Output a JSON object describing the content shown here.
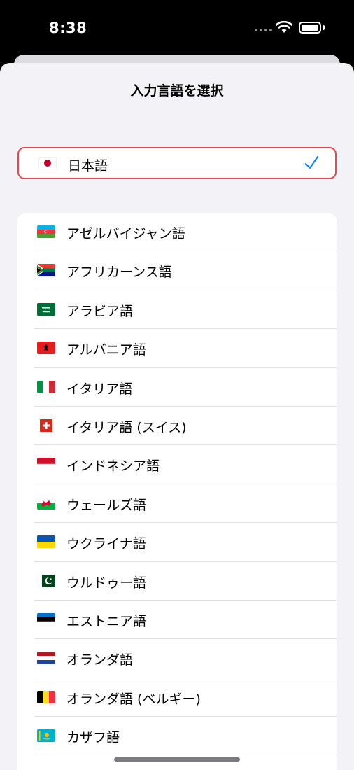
{
  "status_bar": {
    "time": "8:38"
  },
  "sheet": {
    "title": "入力言語を選択"
  },
  "selected": {
    "label": "日本語",
    "flag": "japan-flag-icon"
  },
  "languages": [
    {
      "label": "アゼルバイジャン語",
      "flag": "azerbaijan-flag-icon"
    },
    {
      "label": "アフリカーンス語",
      "flag": "south-africa-flag-icon"
    },
    {
      "label": "アラビア語",
      "flag": "saudi-arabia-flag-icon"
    },
    {
      "label": "アルバニア語",
      "flag": "albania-flag-icon"
    },
    {
      "label": "イタリア語",
      "flag": "italy-flag-icon"
    },
    {
      "label": "イタリア語 (スイス)",
      "flag": "switzerland-flag-icon"
    },
    {
      "label": "インドネシア語",
      "flag": "indonesia-flag-icon"
    },
    {
      "label": "ウェールズ語",
      "flag": "wales-flag-icon"
    },
    {
      "label": "ウクライナ語",
      "flag": "ukraine-flag-icon"
    },
    {
      "label": "ウルドゥー語",
      "flag": "pakistan-flag-icon"
    },
    {
      "label": "エストニア語",
      "flag": "estonia-flag-icon"
    },
    {
      "label": "オランダ語",
      "flag": "netherlands-flag-icon"
    },
    {
      "label": "オランダ語 (ベルギー)",
      "flag": "belgium-flag-icon"
    },
    {
      "label": "カザフ語",
      "flag": "kazakhstan-flag-icon"
    }
  ],
  "colors": {
    "accent": "#007aff",
    "selected_border": "#e5484d"
  }
}
